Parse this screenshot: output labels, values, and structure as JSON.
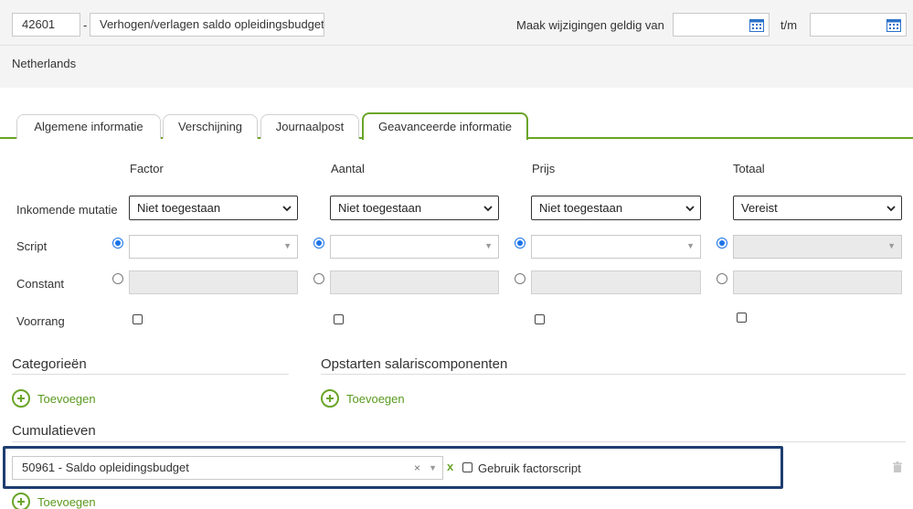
{
  "header": {
    "code": "42601",
    "dash": "-",
    "title": "Verhogen/verlagen saldo opleidingsbudget",
    "valid_from_label": "Maak wijzigingen geldig van",
    "valid_from_value": "",
    "to_label": "t/m",
    "valid_to_value": "",
    "country": "Netherlands"
  },
  "tabs": [
    {
      "label": "Algemene informatie",
      "active": false
    },
    {
      "label": "Verschijning",
      "active": false
    },
    {
      "label": "Journaalpost",
      "active": false
    },
    {
      "label": "Geavanceerde informatie",
      "active": true
    }
  ],
  "grid": {
    "columns": [
      "Factor",
      "Aantal",
      "Prijs",
      "Totaal"
    ],
    "rows": {
      "incoming": "Inkomende mutatie",
      "script": "Script",
      "constant": "Constant",
      "priority": "Voorrang"
    },
    "incoming_values": [
      "Niet toegestaan",
      "Niet toegestaan",
      "Niet toegestaan",
      "Vereist"
    ]
  },
  "categories": {
    "title": "Categorieën",
    "add_label": "Toevoegen"
  },
  "startup": {
    "title": "Opstarten salariscomponenten",
    "add_label": "Toevoegen"
  },
  "cumulatives": {
    "title": "Cumulatieven",
    "item_value": "50961 - Saldo opleidingsbudget",
    "clear_symbol": "×",
    "remove_symbol": "x",
    "factorscript_label": "Gebruik factorscript",
    "add_label": "Toevoegen"
  },
  "colors": {
    "accent_green": "#6aa528",
    "highlight_border": "#1f3e70",
    "radio_blue": "#1a73e8"
  }
}
